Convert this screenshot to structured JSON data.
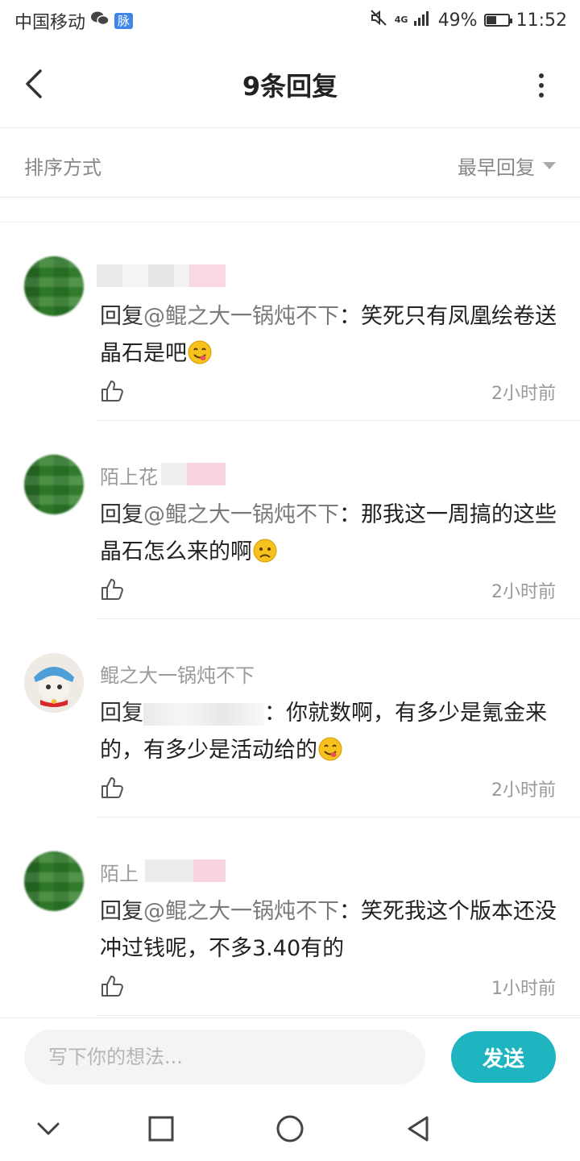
{
  "status_bar": {
    "carrier": "中国移动",
    "badge": "脉",
    "network": "4G",
    "battery": "49%",
    "battery_level": 0.49,
    "time": "11:52"
  },
  "header": {
    "title": "9条回复"
  },
  "sort": {
    "label": "排序方式",
    "selected": "最早回复"
  },
  "comments": [
    {
      "username": "",
      "reply_prefix": "回复",
      "mention": "@鲲之大一锅炖不下",
      "text": "：笑死只有凤凰绘卷送晶石是吧",
      "emoji": "yum-face",
      "time": "2小时前"
    },
    {
      "username": "陌上花",
      "reply_prefix": "回复",
      "mention": "@鲲之大一锅炖不下",
      "text": "：那我这一周搞的这些晶石怎么来的啊",
      "emoji": "worried-face",
      "time": "2小时前"
    },
    {
      "username": "鲲之大一锅炖不下",
      "reply_prefix": "回复",
      "mention": "",
      "text": "：你就数啊，有多少是氪金来的，有多少是活动给的",
      "emoji": "yum-face",
      "time": "2小时前"
    },
    {
      "username": "陌上",
      "reply_prefix": "回复",
      "mention": "@鲲之大一锅炖不下",
      "text": "：笑死我这个版本还没冲过钱呢，不多3.40有的",
      "emoji": "",
      "time": "1小时前"
    }
  ],
  "input": {
    "placeholder": "写下你的想法...",
    "send_label": "发送"
  },
  "colors": {
    "accent": "#1fb5c0",
    "text_primary": "#222222",
    "text_secondary": "#999999"
  }
}
